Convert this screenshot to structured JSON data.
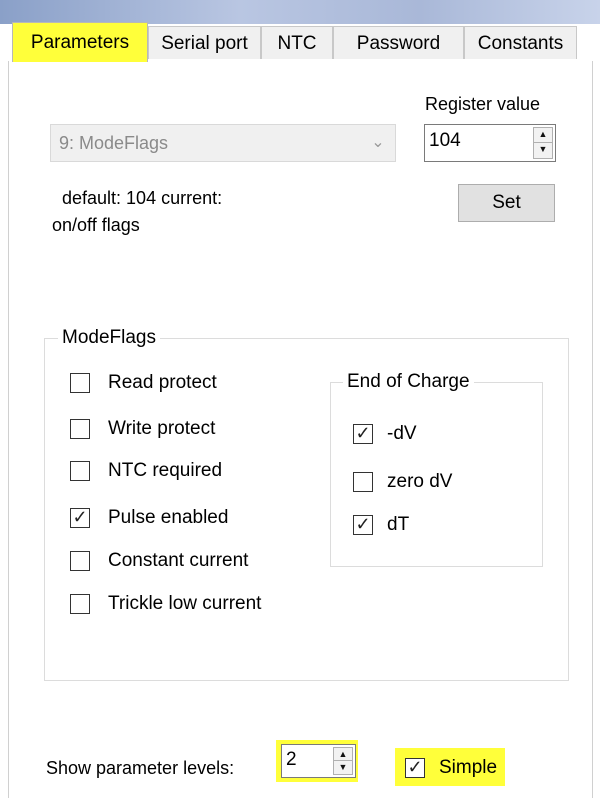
{
  "tabs": [
    {
      "label": "Parameters",
      "active": true
    },
    {
      "label": "Serial port",
      "active": false
    },
    {
      "label": "NTC",
      "active": false
    },
    {
      "label": "Password",
      "active": false
    },
    {
      "label": "Constants",
      "active": false
    }
  ],
  "register": {
    "combo_value": "9: ModeFlags",
    "register_value_label": "Register value",
    "register_value": "104",
    "description_line1": "default: 104 current:",
    "description_line2": "on/off flags",
    "set_button": "Set"
  },
  "modeflags": {
    "title": "ModeFlags",
    "items": [
      {
        "label": "Read protect",
        "checked": false
      },
      {
        "label": "Write protect",
        "checked": false
      },
      {
        "label": "NTC required",
        "checked": false
      },
      {
        "label": "Pulse enabled",
        "checked": true
      },
      {
        "label": "Constant current",
        "checked": false
      },
      {
        "label": "Trickle low current",
        "checked": false
      }
    ],
    "end_of_charge": {
      "title": "End of Charge",
      "items": [
        {
          "label": "-dV",
          "checked": true
        },
        {
          "label": "zero dV",
          "checked": false
        },
        {
          "label": "dT",
          "checked": true
        }
      ]
    }
  },
  "footer": {
    "levels_label": "Show parameter levels:",
    "levels_value": "2",
    "simple_label": "Simple",
    "simple_checked": true
  },
  "colors": {
    "highlight": "#ffff3a",
    "titlebar": "#a9b8d8"
  },
  "icons": {
    "combo_arrow": "chevron-down-icon",
    "spin_up": "spin-up-icon",
    "spin_down": "spin-down-icon",
    "check": "checkmark-icon"
  }
}
